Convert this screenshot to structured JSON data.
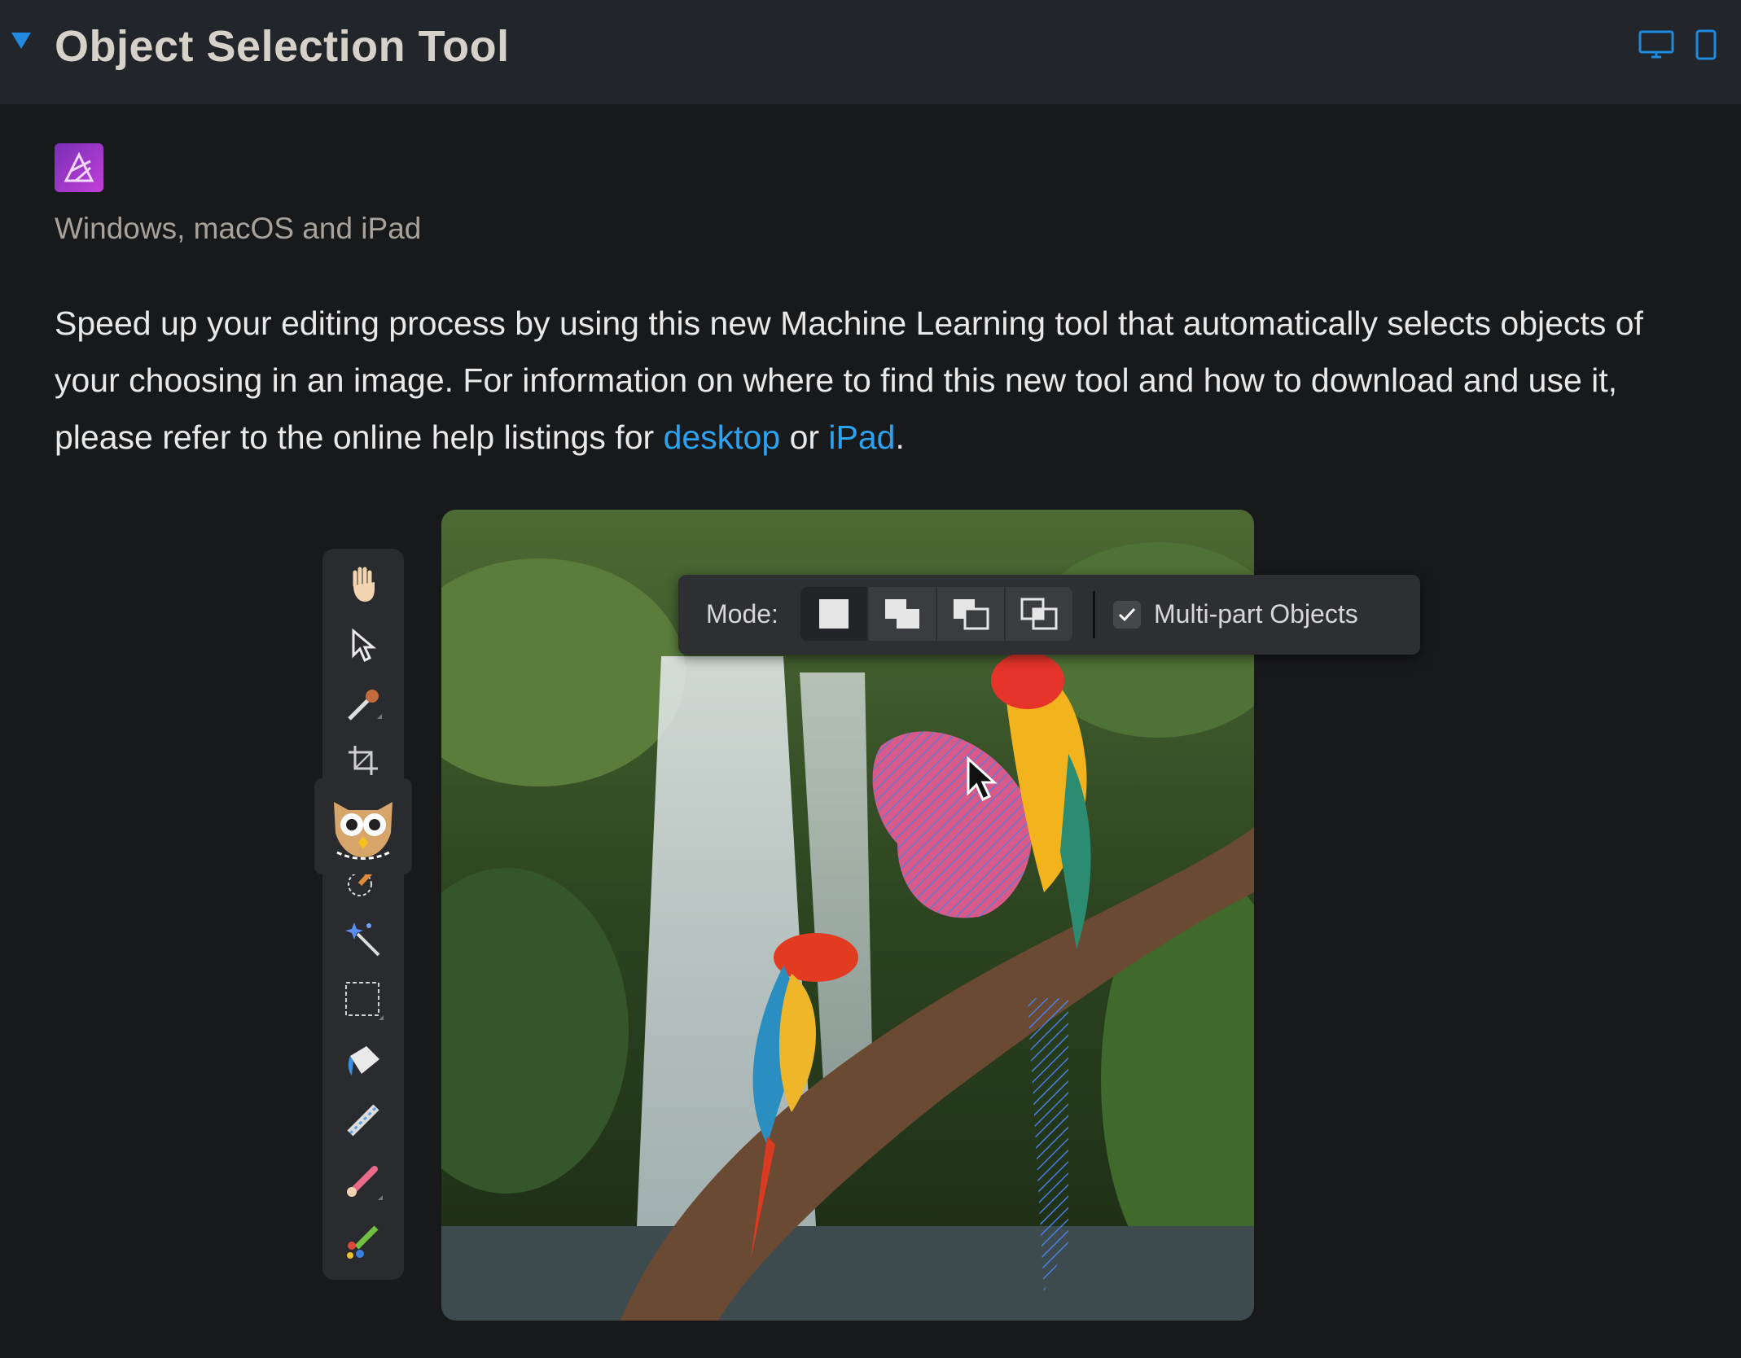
{
  "header": {
    "title": "Object Selection Tool",
    "desktop_icon": "monitor-icon",
    "tablet_icon": "tablet-icon",
    "accent_color": "#1f8be0"
  },
  "app": {
    "icon": "affinity-photo-icon",
    "platforms": "Windows, macOS and iPad"
  },
  "description": {
    "text_before": "Speed up your editing process by using this new Machine Learning tool that automatically selects objects of your choosing in an image. For information on where to find this new tool and how to download and use it, please refer to the online help listings for ",
    "link_desktop": "desktop",
    "text_middle": " or ",
    "link_ipad": "iPad",
    "text_after": ".",
    "link_color": "#2ba3f0"
  },
  "toolbar": {
    "tools": [
      "hand-icon",
      "move-pointer-icon",
      "color-picker-icon",
      "crop-icon",
      "object-selection-owl-icon",
      "selection-brush-icon",
      "magic-wand-icon",
      "marquee-icon",
      "flood-fill-icon",
      "inpainting-icon",
      "paint-brush-icon",
      "mixer-brush-icon"
    ]
  },
  "context_toolbar": {
    "mode_label": "Mode:",
    "modes": [
      "new-selection-icon",
      "add-selection-icon",
      "subtract-selection-icon",
      "intersect-selection-icon"
    ],
    "checkbox_label": "Multi-part Objects",
    "checkbox_checked": true
  },
  "canvas": {
    "image": "parrots-waterfall-photo",
    "cursor": "arrow-cursor-icon"
  }
}
